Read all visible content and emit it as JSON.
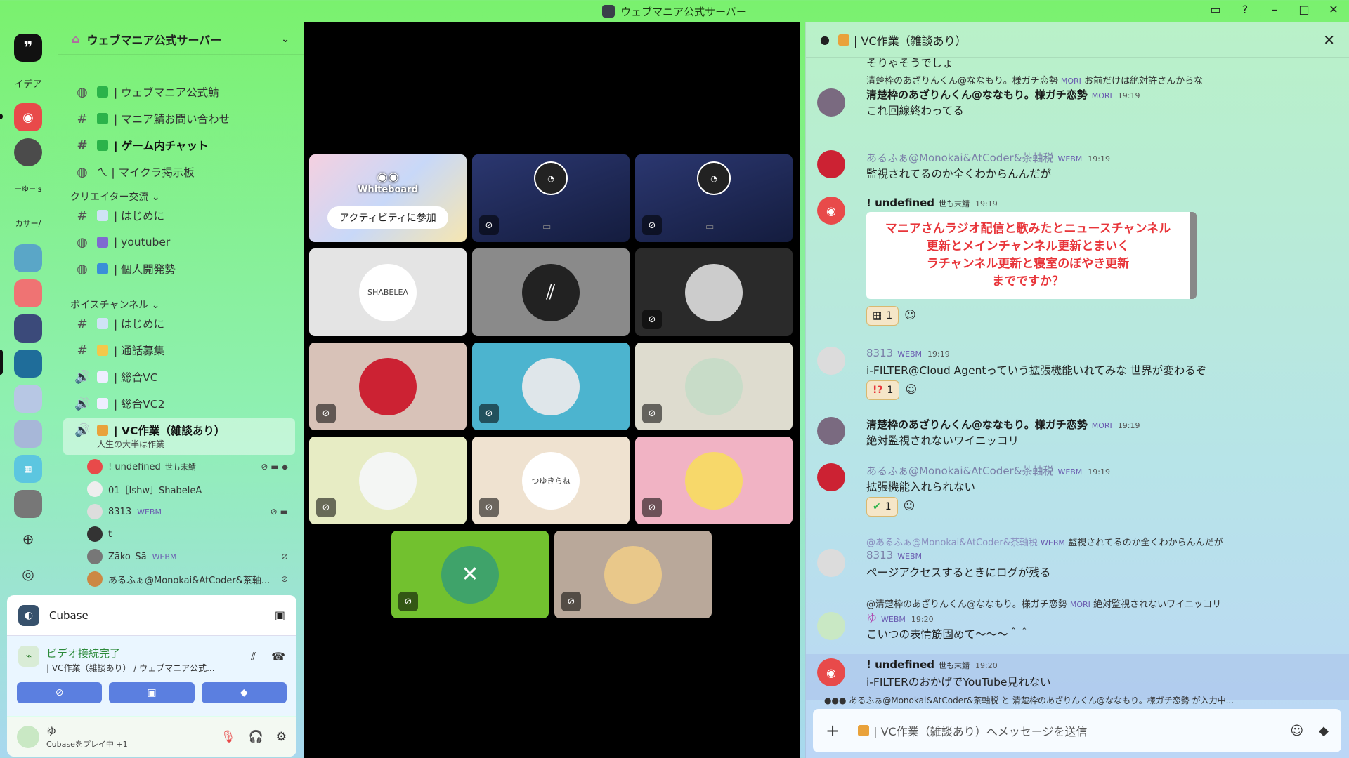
{
  "window": {
    "title": "ウェブマニア公式サーバー"
  },
  "rail": {
    "labels": [
      "イデア",
      "ーゆー's",
      "カサー/"
    ]
  },
  "sidebar": {
    "server_name": "ウェブマニア公式サーバー",
    "channels_top": [
      {
        "label": "| ウェブマニア公式鯖"
      },
      {
        "label": "| マニア鯖お問い合わせ"
      },
      {
        "label": "| ゲーム内チャット"
      },
      {
        "label": "ㄟ | マイクラ掲示板"
      }
    ],
    "category_creator": "クリエイター交流",
    "channels_creator": [
      {
        "label": "| はじめに"
      },
      {
        "label": "| youtuber"
      },
      {
        "label": "| 個人開発勢"
      }
    ],
    "category_voice": "ボイスチャンネル",
    "channels_voice": [
      {
        "label": "| はじめに"
      },
      {
        "label": "| 通話募集"
      },
      {
        "label": "| 総合VC"
      },
      {
        "label": "| 総合VC2"
      }
    ],
    "active_vc": {
      "label": "| VC作業（雑談あり）",
      "topic": "人生の大半は作業"
    },
    "vc_users": [
      {
        "name": "! undefined",
        "tag": "世も末鯖"
      },
      {
        "name": "01［Ishw］ShabeleA",
        "tag": ""
      },
      {
        "name": "8313",
        "tag": "WEBM"
      },
      {
        "name": "t",
        "tag": ""
      },
      {
        "name": "Zāko_Sā",
        "tag": "WEBM"
      },
      {
        "name": "あるふぁ@Monokai&AtCoder&茶軸...",
        "tag": ""
      }
    ]
  },
  "voice_panel": {
    "activity": "Cubase",
    "status": "ビデオ接続完了",
    "location": "| VC作業（雑談あり） / ウェブマニア公式..."
  },
  "user": {
    "name": "ゆ",
    "status": "Cubaseをプレイ中 +1"
  },
  "stage": {
    "whiteboard_label": "Whiteboard",
    "join_button": "アクティビティに参加",
    "shabelea_label": "SHABELEA",
    "yuki_label": "つゆきらね"
  },
  "chat": {
    "channel": "| VC作業（雑談あり）",
    "messages": [
      {
        "text": "そりゃそうでしょ"
      },
      {
        "reply": "清楚枠のあざりんくん@ななもり。様ガチ恋勢",
        "reply_tag": "MORI",
        "reply_text": "お前だけは絶対許さんからな",
        "name": "清楚枠のあざりんくん@ななもり。様ガチ恋勢",
        "tag": "MORI",
        "time": "19:19",
        "text": "これ回線終わってる"
      },
      {
        "name": "あるふぁ@Monokai&AtCoder&茶軸税",
        "tag": "WEBM",
        "time": "19:19",
        "text": "監視されてるのか全くわからんんだが"
      },
      {
        "name": "! undefined",
        "tag": "世も末鯖",
        "time": "19:19",
        "image_lines": [
          "マニアさんラジオ配信と歌みたとニュースチャンネル",
          "更新とメインチャンネル更新とまいく",
          "ラチャンネル更新と寝室のぼやき更新",
          "までですか？"
        ],
        "reaction": "1"
      },
      {
        "name": "8313",
        "tag": "WEBM",
        "time": "19:19",
        "text": "i-FILTER@Cloud Agentっていう拡張機能いれてみな 世界が変わるぞ",
        "reaction": "1"
      },
      {
        "name": "清楚枠のあざりんくん@ななもり。様ガチ恋勢",
        "tag": "MORI",
        "time": "19:19",
        "text": "絶対監視されないワイニッコリ"
      },
      {
        "name": "あるふぁ@Monokai&AtCoder&茶軸税",
        "tag": "WEBM",
        "time": "19:19",
        "text": "拡張機能入れられない",
        "reaction": "1"
      },
      {
        "reply": "@あるふぁ@Monokai&AtCoder&茶軸税",
        "reply_tag": "WEBM",
        "reply_text": "監視されてるのか全くわからんんだが",
        "name": "8313",
        "tag": "WEBM",
        "text": "ページアクセスするときにログが残る"
      },
      {
        "reply": "@清楚枠のあざりんくん@ななもり。様ガチ恋勢",
        "reply_tag": "MORI",
        "reply_text": "絶対監視されないワイニッコリ",
        "name": "ゆ",
        "tag": "WEBM",
        "time": "19:20",
        "text": "こいつの表情筋固めて〜〜〜＾＾"
      },
      {
        "name": "! undefined",
        "tag": "世も末鯖",
        "time": "19:20",
        "text": "i-FILTERのおかげでYouTube見れない"
      }
    ],
    "typing": "あるふぁ@Monokai&AtCoder&茶軸税 と 清楚枠のあざりんくん@ななもり。様ガチ恋勢 が入力中...",
    "composer_placeholder": "| VC作業（雑談あり）へメッセージを送信"
  }
}
